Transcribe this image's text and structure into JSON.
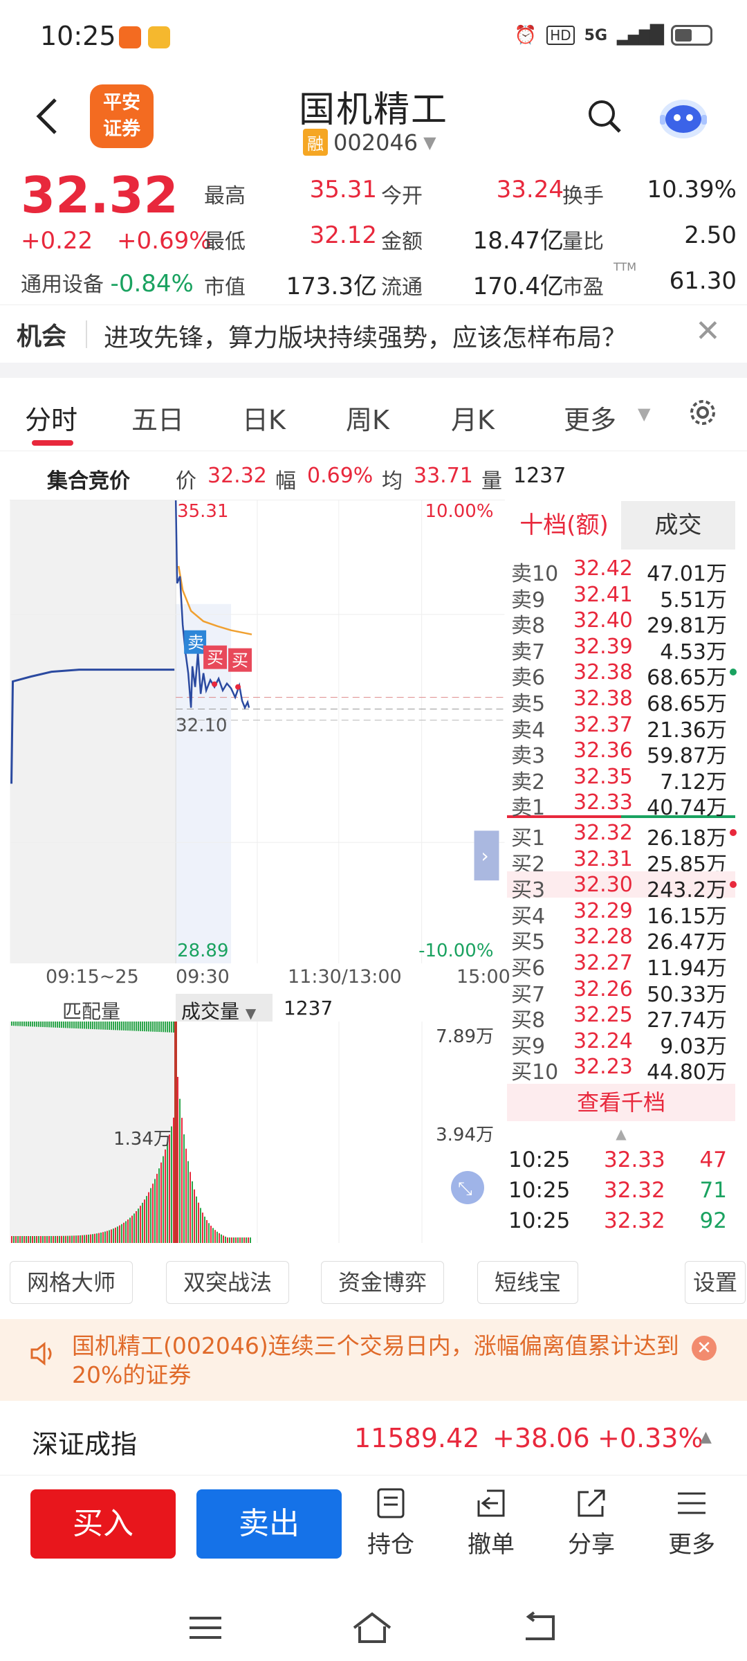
{
  "status_bar": {
    "time": "10:25",
    "network": "5G"
  },
  "header": {
    "logo_line1": "平安",
    "logo_line2": "证券",
    "stock_name": "国机精工",
    "margin_tag": "融",
    "stock_code": "002046"
  },
  "quote": {
    "price": "32.32",
    "change": "+0.22",
    "change_pct": "+0.69%",
    "sector_name": "通用设备",
    "sector_pct": "-0.84%",
    "rows": [
      [
        {
          "label": "最高",
          "value": "35.31",
          "color": "red"
        },
        {
          "label": "今开",
          "value": "33.24",
          "color": "red"
        },
        {
          "label": "换手",
          "value": "10.39%",
          "color": "dark"
        }
      ],
      [
        {
          "label": "最低",
          "value": "32.12",
          "color": "red"
        },
        {
          "label": "金额",
          "value": "18.47亿",
          "color": "dark"
        },
        {
          "label": "量比",
          "value": "2.50",
          "color": "dark"
        }
      ],
      [
        {
          "label": "市值",
          "value": "173.3亿",
          "color": "dark"
        },
        {
          "label": "流通",
          "value": "170.4亿",
          "color": "dark"
        },
        {
          "label": "市盈",
          "value": "61.30",
          "color": "dark",
          "sup": "TTM"
        }
      ]
    ]
  },
  "news": {
    "tag": "机会",
    "text": "进攻先锋，算力版块持续强势，应该怎样布局？"
  },
  "tabs": [
    "分时",
    "五日",
    "日K",
    "周K",
    "月K",
    "更多"
  ],
  "auction": {
    "title": "集合竞价",
    "price_label": "价",
    "price": "32.32",
    "range_label": "幅",
    "range": "0.69%",
    "avg_label": "均",
    "avg": "33.71",
    "vol_label": "量",
    "vol": "1237"
  },
  "chart": {
    "high_label": "35.31",
    "high_pct": "10.00%",
    "low_label": "28.89",
    "low_pct": "-10.00%",
    "mid_label": "32.10",
    "sell_marker": "卖",
    "buy_marker": "买",
    "x_labels": [
      "09:15~25",
      "09:30",
      "11:30/13:00",
      "15:00"
    ],
    "vol_tab_left": "匹配量",
    "vol_tab_right": "成交量",
    "vol_value": "1237",
    "vol_max": "7.89万",
    "vol_mid": "3.94万",
    "vol_peak": "1.34万",
    "colors": {
      "price_line": "#2b4aa0",
      "avg_line": "#f0a030"
    }
  },
  "order_book": {
    "tab_active": "十档(额)",
    "tab_other": "成交",
    "sells": [
      {
        "side": "卖10",
        "price": "32.42",
        "vol": "47.01万"
      },
      {
        "side": "卖9",
        "price": "32.41",
        "vol": "5.51万"
      },
      {
        "side": "卖8",
        "price": "32.40",
        "vol": "29.81万"
      },
      {
        "side": "卖7",
        "price": "32.39",
        "vol": "4.53万"
      },
      {
        "side": "卖6",
        "price": "32.38",
        "vol": "68.65万"
      },
      {
        "side": "卖5",
        "price": "32.38",
        "vol": "68.65万"
      },
      {
        "side": "卖4",
        "price": "32.37",
        "vol": "21.36万"
      },
      {
        "side": "卖3",
        "price": "32.36",
        "vol": "59.87万"
      },
      {
        "side": "卖2",
        "price": "32.35",
        "vol": "7.12万"
      },
      {
        "side": "卖1",
        "price": "32.33",
        "vol": "40.74万"
      }
    ],
    "buys": [
      {
        "side": "买1",
        "price": "32.32",
        "vol": "26.18万"
      },
      {
        "side": "买2",
        "price": "32.31",
        "vol": "25.85万"
      },
      {
        "side": "买3",
        "price": "32.30",
        "vol": "243.2万"
      },
      {
        "side": "买4",
        "price": "32.29",
        "vol": "16.15万"
      },
      {
        "side": "买5",
        "price": "32.28",
        "vol": "26.47万"
      },
      {
        "side": "买6",
        "price": "32.27",
        "vol": "11.94万"
      },
      {
        "side": "买7",
        "price": "32.26",
        "vol": "50.33万"
      },
      {
        "side": "买8",
        "price": "32.25",
        "vol": "27.74万"
      },
      {
        "side": "买9",
        "price": "32.24",
        "vol": "9.03万"
      },
      {
        "side": "买10",
        "price": "32.23",
        "vol": "44.80万"
      }
    ],
    "view_more": "查看千档",
    "trades": [
      {
        "time": "10:25",
        "price": "32.33",
        "vol": "47",
        "dir": "red"
      },
      {
        "time": "10:25",
        "price": "32.32",
        "vol": "71",
        "dir": "green"
      },
      {
        "time": "10:25",
        "price": "32.32",
        "vol": "92",
        "dir": "green"
      }
    ]
  },
  "tools": [
    "网格大师",
    "双突战法",
    "资金博弈",
    "短线宝",
    "设置"
  ],
  "alert": {
    "text": "国机精工(002046)连续三个交易日内，涨幅偏离值累计达到20%的证券"
  },
  "index": {
    "name": "深证成指",
    "value": "11589.42",
    "change": "+38.06",
    "pct": "+0.33%"
  },
  "actions": {
    "buy": "买入",
    "sell": "卖出",
    "hold": "持仓",
    "cancel": "撤单",
    "share": "分享",
    "more": "更多"
  }
}
